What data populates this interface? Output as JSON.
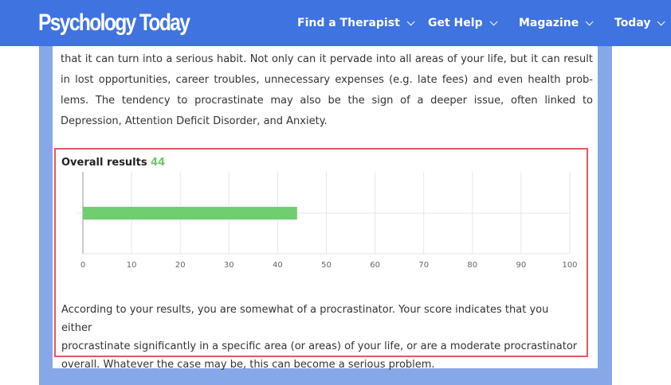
{
  "header": {
    "logo": "Psychology Today",
    "nav": [
      {
        "label": "Find a Therapist"
      },
      {
        "label": "Get Help"
      },
      {
        "label": "Magazine"
      },
      {
        "label": "Today"
      }
    ]
  },
  "article": {
    "lines": [
      "that it can turn into a serious habit. Not only can it pervade into all areas of your life, but it can result",
      "in lost opportunities, career troubles, unnecessary expenses (e.g. late fees) and even health prob-",
      "lems. The tendency to procrastinate may also be the sign of a deeper issue, often linked to",
      "Depression, Attention Deficit Disorder, and Anxiety."
    ]
  },
  "results": {
    "title_label": "Overall results",
    "score": "44",
    "description_lines": [
      "According to your results, you are somewhat of a procrastinator. Your score indicates that you either",
      "procrastinate significantly in a specific area (or areas) of your life, or are a moderate procrastinator",
      "overall. Whatever the case may be, this can become a serious problem."
    ]
  },
  "chart_data": {
    "type": "bar",
    "orientation": "horizontal",
    "categories": [
      ""
    ],
    "values": [
      44
    ],
    "xlim": [
      0,
      100
    ],
    "ticks": [
      "0",
      "10",
      "20",
      "30",
      "40",
      "50",
      "60",
      "70",
      "80",
      "90",
      "100"
    ],
    "grid": true,
    "bar_color": "#6fcf6f"
  },
  "colors": {
    "header": "#3f73e0",
    "backdrop": "#86a8e8",
    "highlight_border": "#e05a63",
    "score": "#69c86a"
  }
}
